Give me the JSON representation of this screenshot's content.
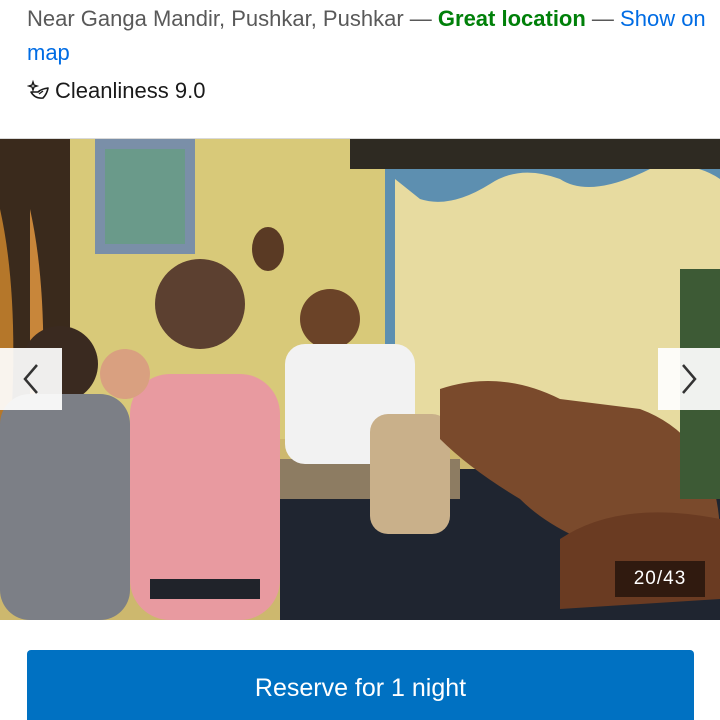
{
  "location": {
    "address": "Near Ganga Mandir, Pushkar, Pushkar",
    "separator_1": " — ",
    "highlight": "Great location",
    "separator_2": " — ",
    "map_link": "Show on map"
  },
  "rating": {
    "label": "Cleanliness 9.0"
  },
  "gallery": {
    "counter": "20/43",
    "current_index": 20,
    "total": 43
  },
  "actions": {
    "reserve_label": "Reserve for 1 night"
  },
  "colors": {
    "great_location": "#008009",
    "link": "#006ce4",
    "primary_button": "#0071c2"
  },
  "icons": {
    "cleanliness": "sparkle-icon",
    "prev": "chevron-left-icon",
    "next": "chevron-right-icon"
  }
}
